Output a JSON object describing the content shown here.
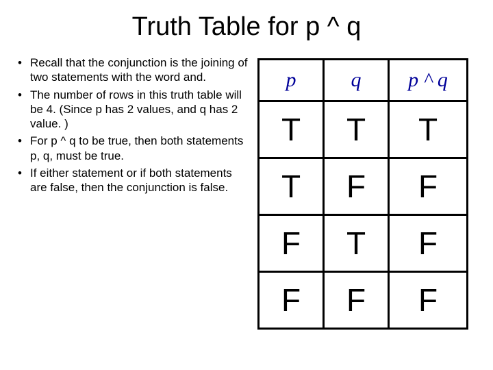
{
  "title": "Truth Table for p ^ q",
  "bullets": [
    "Recall that the conjunction is the joining of two statements with the word and.",
    "The number of rows in this truth table will be 4. (Since p has 2 values, and q has 2 value. )",
    "For p ^ q to be true, then both statements p, q, must be true.",
    "If either statement or if both statements are false, then the conjunction is false."
  ],
  "chart_data": {
    "type": "table",
    "headers": [
      "p",
      "q",
      "p ^ q"
    ],
    "rows": [
      [
        "T",
        "T",
        "T"
      ],
      [
        "T",
        "F",
        "F"
      ],
      [
        "F",
        "T",
        "F"
      ],
      [
        "F",
        "F",
        "F"
      ]
    ]
  }
}
